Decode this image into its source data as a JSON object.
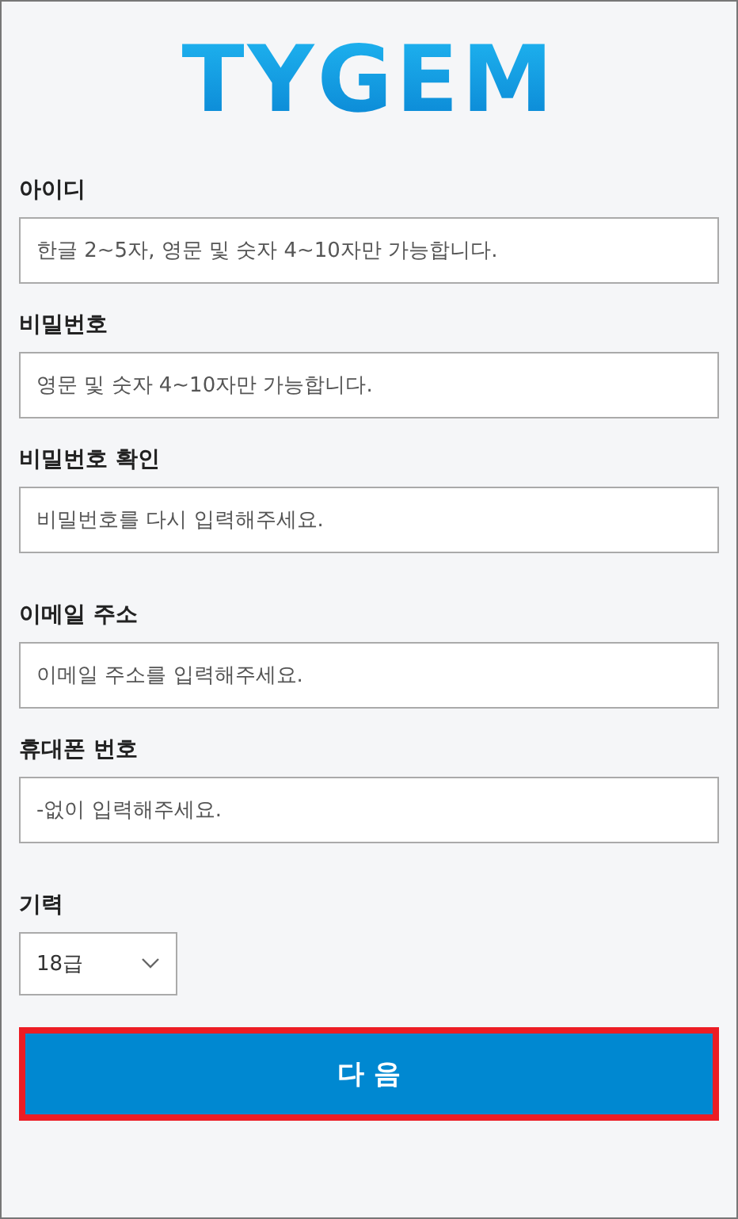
{
  "logo": {
    "text": "TYGEM"
  },
  "sections": [
    {
      "fields": [
        {
          "kind": "text",
          "label": "아이디",
          "placeholder": "한글 2~5자, 영문 및 숫자 4~10자만 가능합니다."
        },
        {
          "kind": "text",
          "label": "비밀번호",
          "placeholder": "영문 및 숫자 4~10자만 가능합니다."
        },
        {
          "kind": "text",
          "label": "비밀번호 확인",
          "placeholder": "비밀번호를 다시 입력해주세요."
        }
      ]
    },
    {
      "fields": [
        {
          "kind": "text",
          "label": "이메일 주소",
          "placeholder": "이메일 주소를 입력해주세요."
        },
        {
          "kind": "text",
          "label": "휴대폰 번호",
          "placeholder": "-없이 입력해주세요."
        }
      ]
    },
    {
      "fields": [
        {
          "kind": "select",
          "label": "기력",
          "value": "18급"
        }
      ]
    }
  ],
  "next_button": {
    "label": "다 음",
    "highlighted": true
  }
}
